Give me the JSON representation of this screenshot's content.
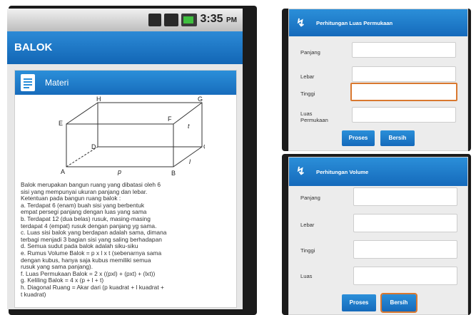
{
  "left": {
    "status_time": "3:35",
    "status_ampm": "PM",
    "app_title": "BALOK",
    "card_title": "Materi",
    "diagram": {
      "vertices": [
        "A",
        "B",
        "C",
        "D",
        "E",
        "F",
        "G",
        "H"
      ],
      "edge_labels": [
        "p",
        "l",
        "t"
      ]
    },
    "description_lines": [
      "Balok merupakan bangun ruang yang dibatasi oleh 6",
      "sisi yang mempunyai ukuran panjang dan lebar.",
      "Ketentuan pada bangun ruang balok :",
      "a. Terdapat 6 (enam) buah sisi yang berbentuk",
      "empat persegi panjang dengan luas yang sama",
      "b. Terdapat 12 (dua belas) rusuk, masing-masing",
      "terdapat 4 (empat) rusuk dengan panjang yg sama.",
      "c. Luas sisi balok yang berdapan adalah sama, dimana",
      "terbagi menjadi 3 bagian sisi yang saling berhadapan",
      "d. Semua sudut pada balok adalah siku-siku",
      "e. Rumus Volume Balok = p x l x t (sebenarnya sama",
      "dengan kubus, hanya saja kubus memiliki semua",
      "rusuk yang sama panjang).",
      "f. Luas Permukaan Balok = 2 x ((pxl) + (pxt) + (lxt))",
      "g. Keliling Balok = 4 x (p + l + t)",
      "h. Diagonal Ruang = Akar dari (p kuadrat + l kuadrat +",
      "t kuadrat)"
    ]
  },
  "luas_panel": {
    "title": "Perhitungan Luas Permukaan",
    "fields": [
      {
        "label": "Panjang",
        "value": ""
      },
      {
        "label": "Lebar",
        "value": ""
      },
      {
        "label": "Tinggi",
        "value": ""
      },
      {
        "label1": "Luas",
        "label2": "Permukaan",
        "value": ""
      }
    ],
    "btn_proses": "Proses",
    "btn_bersih": "Bersih"
  },
  "volume_panel": {
    "title": "Perhitungan Volume",
    "fields": [
      {
        "label": "Panjang",
        "value": ""
      },
      {
        "label": "Lebar",
        "value": ""
      },
      {
        "label": "Tinggi",
        "value": ""
      },
      {
        "label": "Luas",
        "value": ""
      }
    ],
    "btn_proses": "Proses",
    "btn_bersih": "Bersih"
  },
  "colors": {
    "accent_blue": "#1f7bc9",
    "focus_orange": "#d9782f"
  }
}
